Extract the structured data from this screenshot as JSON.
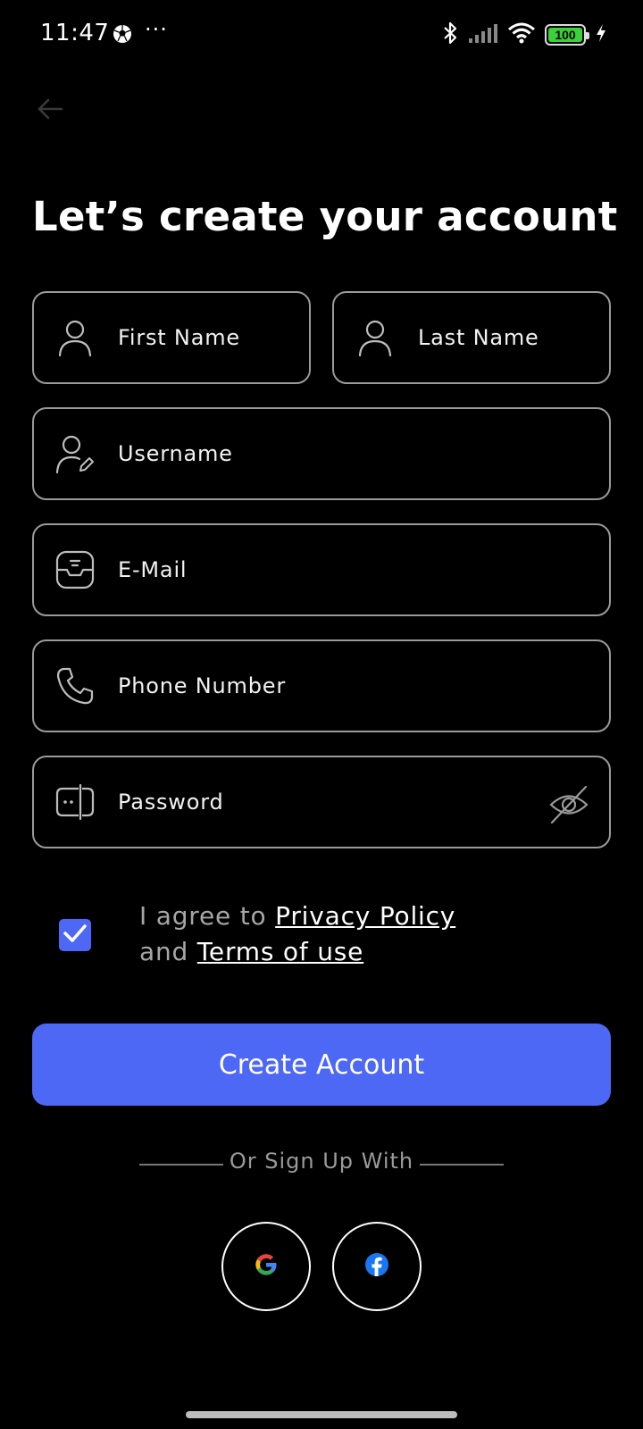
{
  "status_bar": {
    "time": "11:47",
    "overflow": "···",
    "battery_level": "100",
    "icons": [
      "soccer-ball-icon",
      "bluetooth-icon",
      "signal-icon",
      "wifi-icon",
      "battery-icon",
      "charging-icon"
    ]
  },
  "back_icon": "arrow-left-icon",
  "title": "Let’s create your account",
  "form": {
    "first_name": {
      "label": "First Name",
      "icon": "user-icon"
    },
    "last_name": {
      "label": "Last Name",
      "icon": "user-icon"
    },
    "username": {
      "label": "Username",
      "icon": "user-edit-icon"
    },
    "email": {
      "label": "E-Mail",
      "icon": "inbox-icon"
    },
    "phone": {
      "label": "Phone Number",
      "icon": "phone-icon"
    },
    "password": {
      "label": "Password",
      "icon": "password-icon",
      "toggle_icon": "eye-off-icon"
    }
  },
  "agreement": {
    "checked": true,
    "prefix": "I agree to",
    "privacy_link": "Privacy Policy",
    "joiner": "and",
    "terms_link": "Terms of use"
  },
  "primary_button": "Create Account",
  "divider": "Or Sign Up With",
  "social": [
    {
      "name": "google",
      "icon": "google-icon"
    },
    {
      "name": "facebook",
      "icon": "facebook-icon"
    }
  ],
  "colors": {
    "background": "#000000",
    "accent": "#4E68F6",
    "field_border": "#9A9A9A",
    "muted_text": "#A6A6A6"
  }
}
